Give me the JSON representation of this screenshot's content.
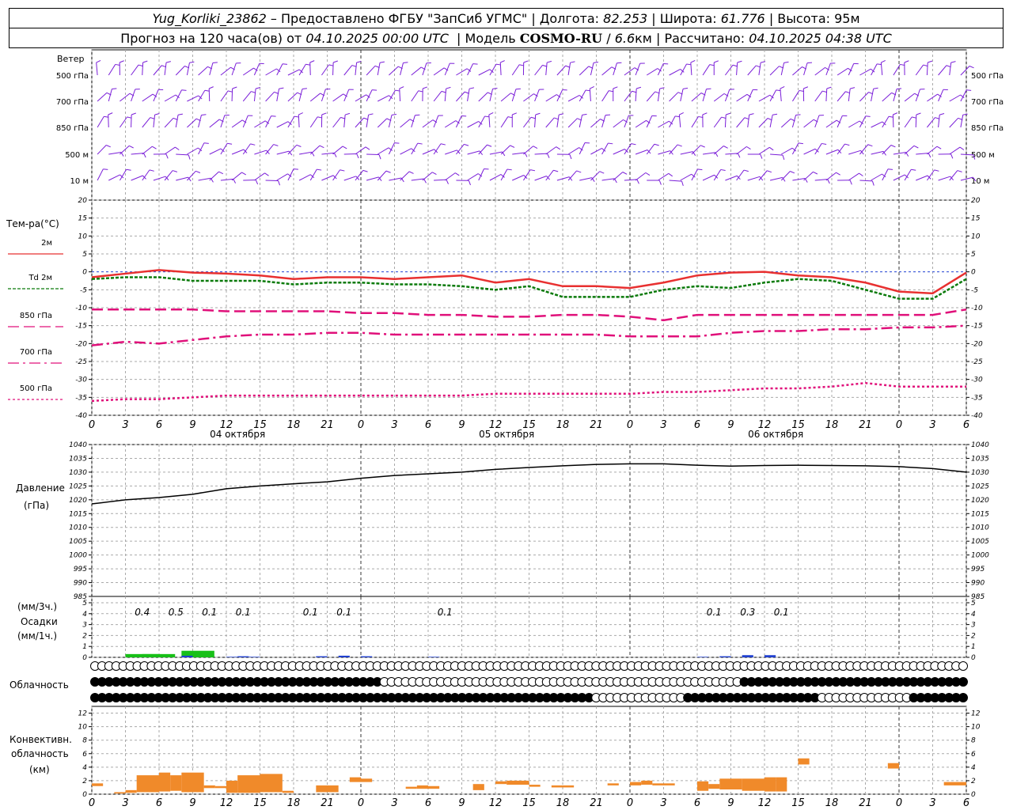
{
  "header": {
    "station": "Yug_Korliki_23862",
    "provider": "Предоставлено ФГБУ \"ЗапСиб УГМС\"",
    "lon_label": "Долгота:",
    "lon": "82.253",
    "lat_label": "Широта:",
    "lat": "61.776",
    "alt_label": "Высота:",
    "alt": "95м",
    "forecast": "Прогноз на 120 часа(ов) от",
    "run": "04.10.2025 00:00 UTC",
    "model_label": "Модель",
    "model": "COSMO-RU",
    "res": "6.6",
    "res_unit": "км",
    "calc_label": "Рассчитано:",
    "calc": "04.10.2025 04:38 UTC"
  },
  "colors": {
    "t2m": "#e83030",
    "td2m": "#0a7a0a",
    "t850": "#e0107a",
    "t700": "#e0107a",
    "t500": "#e0107a",
    "wind": "#7a1ed8",
    "pressure": "#000000",
    "precip_1h": "#2040d0",
    "precip_3h": "#18c018",
    "convective": "#f08a2a"
  },
  "panels": {
    "wind": {
      "title": "Ветер",
      "levels": [
        "500 гПа",
        "700 гПа",
        "850 гПа",
        "500 м",
        "10 м"
      ]
    },
    "temp": {
      "title": "Тем-ра(°С)",
      "legend": [
        {
          "label": "2м",
          "key": "t2m"
        },
        {
          "label": "Td 2м",
          "key": "td2m"
        },
        {
          "label": "850 гПа",
          "key": "t850"
        },
        {
          "label": "700 гПа",
          "key": "t700"
        },
        {
          "label": "500 гПа",
          "key": "t500"
        }
      ]
    },
    "pressure": {
      "title": "Давление",
      "unit": "(гПа)"
    },
    "precip": {
      "label_3h": "(мм/3ч.)",
      "title": "Осадки",
      "label_1h": "(мм/1ч.)"
    },
    "clouds": {
      "title": "Облачность"
    },
    "convective": {
      "title1": "Конвективн.",
      "title2": "облачность",
      "unit": "(км)"
    }
  },
  "time_axis": {
    "tick_labels": [
      "0",
      "3",
      "6",
      "9",
      "12",
      "15",
      "18",
      "21",
      "0",
      "3",
      "6",
      "9",
      "12",
      "15",
      "18",
      "21",
      "0",
      "3",
      "6",
      "9",
      "12",
      "15",
      "18",
      "21",
      "0",
      "3",
      "6"
    ],
    "day_labels": [
      "04 октября",
      "05 октября",
      "06 октября"
    ]
  },
  "chart_data": [
    {
      "type": "line",
      "title": "Тем-ра(°С)",
      "x_hours": [
        0,
        3,
        6,
        9,
        12,
        15,
        18,
        21,
        24,
        27,
        30,
        33,
        36,
        39,
        42,
        45,
        48,
        51,
        54,
        57,
        60,
        63,
        66,
        69,
        72,
        75,
        78
      ],
      "ylim": [
        -40,
        20
      ],
      "yticks": [
        20,
        15,
        10,
        5,
        0,
        -5,
        -10,
        -15,
        -20,
        -25,
        -30,
        -35,
        -40
      ],
      "grid": true,
      "series": [
        {
          "name": "2м",
          "values": [
            -1.5,
            -0.5,
            0.5,
            -0.2,
            -0.5,
            -1,
            -2,
            -1.5,
            -1.5,
            -2,
            -1.5,
            -1,
            -3,
            -2,
            -4,
            -4,
            -4.5,
            -3,
            -1,
            -0.2,
            0,
            -1,
            -1.5,
            -3,
            -5.5,
            -6,
            -0.2
          ]
        },
        {
          "name": "Td 2м",
          "values": [
            -2,
            -1.5,
            -1.5,
            -2.5,
            -2.5,
            -2.5,
            -3.5,
            -3,
            -3,
            -3.5,
            -3.5,
            -4,
            -5,
            -4,
            -7,
            -7,
            -7,
            -5,
            -4,
            -4.5,
            -3,
            -2,
            -2.5,
            -5,
            -7.5,
            -7.5,
            -2
          ]
        },
        {
          "name": "850 гПа",
          "values": [
            -10.5,
            -10.5,
            -10.5,
            -10.5,
            -11,
            -11,
            -11,
            -11,
            -11.5,
            -11.5,
            -12,
            -12,
            -12.5,
            -12.5,
            -12,
            -12,
            -12.5,
            -13.5,
            -12,
            -12,
            -12,
            -12,
            -12,
            -12,
            -12,
            -12,
            -10.5
          ]
        },
        {
          "name": "700 гПа",
          "values": [
            -20.5,
            -19.5,
            -20,
            -19,
            -18,
            -17.5,
            -17.5,
            -17,
            -17,
            -17.5,
            -17.5,
            -17.5,
            -17.5,
            -17.5,
            -17.5,
            -17.5,
            -18,
            -18,
            -18,
            -17,
            -16.5,
            -16.5,
            -16,
            -16,
            -15.5,
            -15.5,
            -15
          ]
        },
        {
          "name": "500 гПа",
          "values": [
            -36,
            -35.5,
            -35.5,
            -35,
            -34.5,
            -34.5,
            -34.5,
            -34.5,
            -34.5,
            -34.5,
            -34.5,
            -34.5,
            -34,
            -34,
            -34,
            -34,
            -34,
            -33.5,
            -33.5,
            -33,
            -32.5,
            -32.5,
            -32,
            -31,
            -32,
            -32,
            -32
          ]
        }
      ]
    },
    {
      "type": "line",
      "title": "Давление",
      "ylabel": "(гПа)",
      "x_hours": [
        0,
        3,
        6,
        9,
        12,
        15,
        18,
        21,
        24,
        27,
        30,
        33,
        36,
        39,
        42,
        45,
        48,
        51,
        54,
        57,
        60,
        63,
        66,
        69,
        72,
        75,
        78
      ],
      "ylim": [
        985,
        1040
      ],
      "yticks": [
        1040,
        1035,
        1030,
        1025,
        1020,
        1015,
        1010,
        1005,
        1000,
        995,
        990,
        985
      ],
      "series": [
        {
          "name": "",
          "values": [
            1018.5,
            1020,
            1020.8,
            1022,
            1024,
            1025,
            1025.8,
            1026.5,
            1027.8,
            1028.8,
            1029.4,
            1030,
            1031,
            1031.7,
            1032.3,
            1032.8,
            1033,
            1033,
            1032.5,
            1032.2,
            1032.4,
            1032.5,
            1032.4,
            1032.3,
            1032,
            1031.3,
            1030
          ]
        }
      ]
    },
    {
      "type": "bar",
      "title": "Осадки",
      "ylim": [
        0,
        5
      ],
      "yticks": [
        5,
        4,
        3,
        2,
        1,
        0
      ],
      "annotations_3h": [
        {
          "hour": 4.5,
          "label": "0.4"
        },
        {
          "hour": 7.5,
          "label": "0.5"
        },
        {
          "hour": 10.5,
          "label": "0.1"
        },
        {
          "hour": 13.5,
          "label": "0.1"
        },
        {
          "hour": 19.5,
          "label": "0.1"
        },
        {
          "hour": 22.5,
          "label": "0.1"
        },
        {
          "hour": 31.5,
          "label": "0.1"
        },
        {
          "hour": 55.5,
          "label": "0.1"
        },
        {
          "hour": 58.5,
          "label": "0.3"
        },
        {
          "hour": 61.5,
          "label": "0.1"
        }
      ],
      "series": [
        {
          "name": "мм/3ч.",
          "bars": [
            {
              "hour": 3,
              "value": 0.3
            },
            {
              "hour": 4.5,
              "value": 0.3
            },
            {
              "hour": 8,
              "value": 0.6
            }
          ]
        },
        {
          "name": "мм/1ч.",
          "bars": [
            {
              "hour": 8,
              "value": 0.15
            },
            {
              "hour": 12,
              "value": 0.05
            },
            {
              "hour": 13,
              "value": 0.1
            },
            {
              "hour": 14,
              "value": 0.05
            },
            {
              "hour": 20,
              "value": 0.1
            },
            {
              "hour": 22,
              "value": 0.15
            },
            {
              "hour": 24,
              "value": 0.1
            },
            {
              "hour": 30,
              "value": 0.05
            },
            {
              "hour": 54,
              "value": 0.05
            },
            {
              "hour": 56,
              "value": 0.1
            },
            {
              "hour": 58,
              "value": 0.2
            },
            {
              "hour": 60,
              "value": 0.2
            }
          ]
        }
      ]
    },
    {
      "type": "table",
      "title": "Облачность",
      "rows": [
        "0000000000000000000000000000000000000000000000000000000000000000000000000000000000000000000000000000000000000000000000000000",
        "1111111111111111111111111111111111111111100000000000000000000000000000000000000000000000000011111111111111111111111111111111",
        "1111111111111111111111111111111111111111111111111111111111111111111111100000000000001111111111111111111000000000000011111111"
      ]
    },
    {
      "type": "bar",
      "title": "Конвективн. облачность",
      "ylabel": "(км)",
      "ylim": [
        0,
        13
      ],
      "yticks": [
        12,
        10,
        8,
        6,
        4,
        2,
        0
      ],
      "segments": [
        {
          "from": 0,
          "to": 1,
          "base": 1.2,
          "top": 1.6
        },
        {
          "from": 2,
          "to": 3,
          "base": 0.1,
          "top": 0.3
        },
        {
          "from": 3,
          "to": 4,
          "base": 0.2,
          "top": 0.6
        },
        {
          "from": 4,
          "to": 6,
          "base": 0.3,
          "top": 2.8
        },
        {
          "from": 6,
          "to": 7,
          "base": 0.4,
          "top": 3.2
        },
        {
          "from": 7,
          "to": 8,
          "base": 0.5,
          "top": 2.8
        },
        {
          "from": 8,
          "to": 10,
          "base": 0.3,
          "top": 3.2
        },
        {
          "from": 10,
          "to": 11,
          "base": 0.9,
          "top": 1.3
        },
        {
          "from": 11,
          "to": 12,
          "base": 0.9,
          "top": 1.2
        },
        {
          "from": 12,
          "to": 13,
          "base": 0.2,
          "top": 2.0
        },
        {
          "from": 13,
          "to": 15,
          "base": 0.2,
          "top": 2.8
        },
        {
          "from": 15,
          "to": 17,
          "base": 0.3,
          "top": 3.0
        },
        {
          "from": 17,
          "to": 18,
          "base": 0.2,
          "top": 0.5
        },
        {
          "from": 20,
          "to": 22,
          "base": 0.3,
          "top": 1.3
        },
        {
          "from": 23,
          "to": 24,
          "base": 1.8,
          "top": 2.5
        },
        {
          "from": 24,
          "to": 25,
          "base": 1.8,
          "top": 2.3
        },
        {
          "from": 28,
          "to": 29,
          "base": 0.8,
          "top": 1.1
        },
        {
          "from": 29,
          "to": 30,
          "base": 0.8,
          "top": 1.3
        },
        {
          "from": 30,
          "to": 31,
          "base": 0.8,
          "top": 1.2
        },
        {
          "from": 34,
          "to": 35,
          "base": 0.6,
          "top": 1.5
        },
        {
          "from": 36,
          "to": 37,
          "base": 1.5,
          "top": 1.9
        },
        {
          "from": 37,
          "to": 39,
          "base": 1.4,
          "top": 2.0
        },
        {
          "from": 39,
          "to": 40,
          "base": 1.1,
          "top": 1.4
        },
        {
          "from": 41,
          "to": 43,
          "base": 1.0,
          "top": 1.3
        },
        {
          "from": 46,
          "to": 47,
          "base": 1.3,
          "top": 1.6
        },
        {
          "from": 48,
          "to": 49,
          "base": 1.3,
          "top": 1.8
        },
        {
          "from": 49,
          "to": 50,
          "base": 1.4,
          "top": 2.0
        },
        {
          "from": 50,
          "to": 52,
          "base": 1.3,
          "top": 1.6
        },
        {
          "from": 54,
          "to": 55,
          "base": 0.5,
          "top": 1.9
        },
        {
          "from": 55,
          "to": 56,
          "base": 0.8,
          "top": 1.5
        },
        {
          "from": 56,
          "to": 58,
          "base": 0.7,
          "top": 2.3
        },
        {
          "from": 58,
          "to": 60,
          "base": 0.5,
          "top": 2.3
        },
        {
          "from": 60,
          "to": 61,
          "base": 0.4,
          "top": 2.5
        },
        {
          "from": 61,
          "to": 62,
          "base": 0.4,
          "top": 2.5
        },
        {
          "from": 63,
          "to": 64,
          "base": 4.4,
          "top": 5.3
        },
        {
          "from": 71,
          "to": 72,
          "base": 3.8,
          "top": 4.6
        },
        {
          "from": 76,
          "to": 78,
          "base": 1.3,
          "top": 1.8
        }
      ]
    }
  ]
}
